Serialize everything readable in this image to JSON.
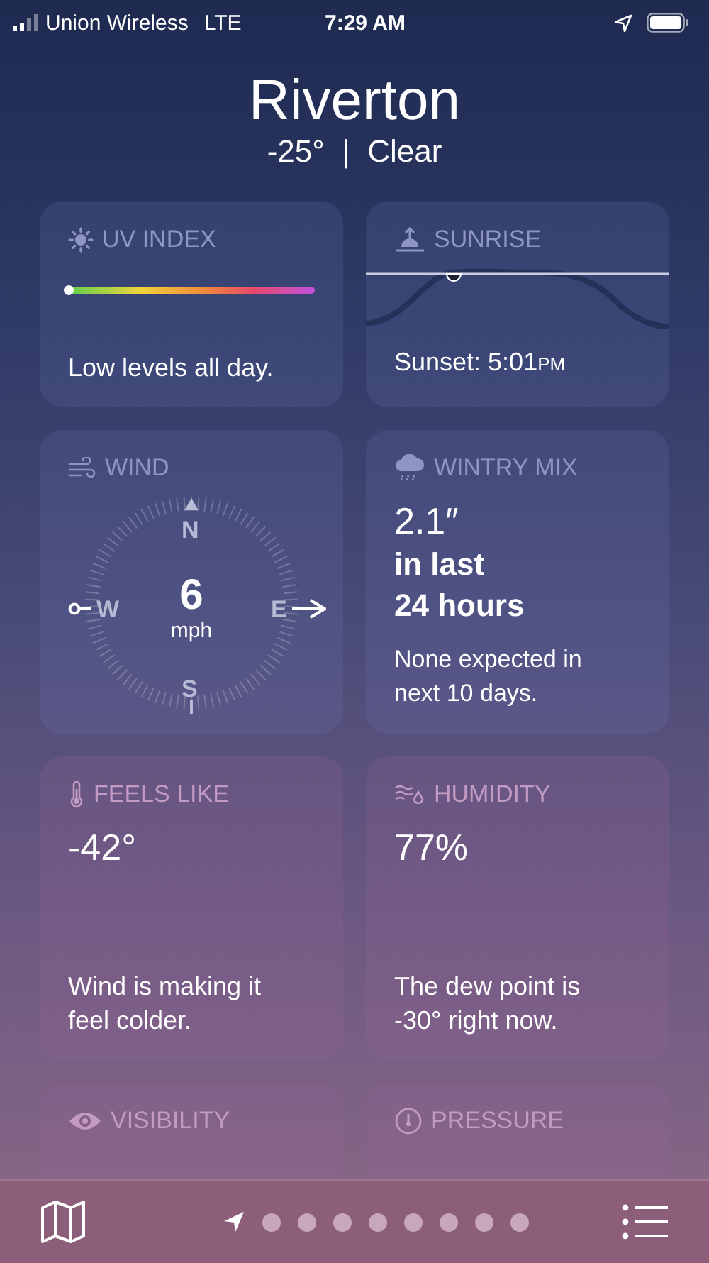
{
  "status_bar": {
    "carrier": "Union Wireless",
    "network": "LTE",
    "time": "7:29 AM"
  },
  "location": {
    "city": "Riverton",
    "summary": "-25°  |  Clear"
  },
  "cards": [
    {
      "kind": "uv",
      "title": "UV INDEX",
      "level": 0,
      "text": "Low levels all day."
    },
    {
      "kind": "sunrise",
      "title": "SUNRISE",
      "text": "Sunset: 5:01",
      "suffix": "PM"
    },
    {
      "kind": "wind",
      "title": "WIND",
      "speed": "6",
      "unit": "mph",
      "north": "N",
      "south": "S",
      "west": "W",
      "east": "E"
    },
    {
      "kind": "precip",
      "title": "WINTRY MIX",
      "value": "2.1″",
      "lines": [
        "in last",
        "24 hours"
      ],
      "text": "None expected in next 10 days."
    },
    {
      "kind": "feels",
      "title": "FEELS LIKE",
      "value": "-42°",
      "text": "Wind is making it feel colder."
    },
    {
      "kind": "humidity",
      "title": "HUMIDITY",
      "value": "77%",
      "text": "The dew point is -30° right now."
    },
    {
      "kind": "visibility",
      "title": "VISIBILITY"
    },
    {
      "kind": "pressure",
      "title": "PRESSURE"
    }
  ],
  "pages": [
    {
      "kind": "location",
      "selected": true
    },
    {
      "kind": "dot",
      "selected": false
    },
    {
      "kind": "dot",
      "selected": false
    },
    {
      "kind": "dot",
      "selected": false
    },
    {
      "kind": "dot",
      "selected": false
    },
    {
      "kind": "dot",
      "selected": false
    },
    {
      "kind": "dot",
      "selected": false
    },
    {
      "kind": "dot",
      "selected": false
    },
    {
      "kind": "dot",
      "selected": false
    }
  ]
}
